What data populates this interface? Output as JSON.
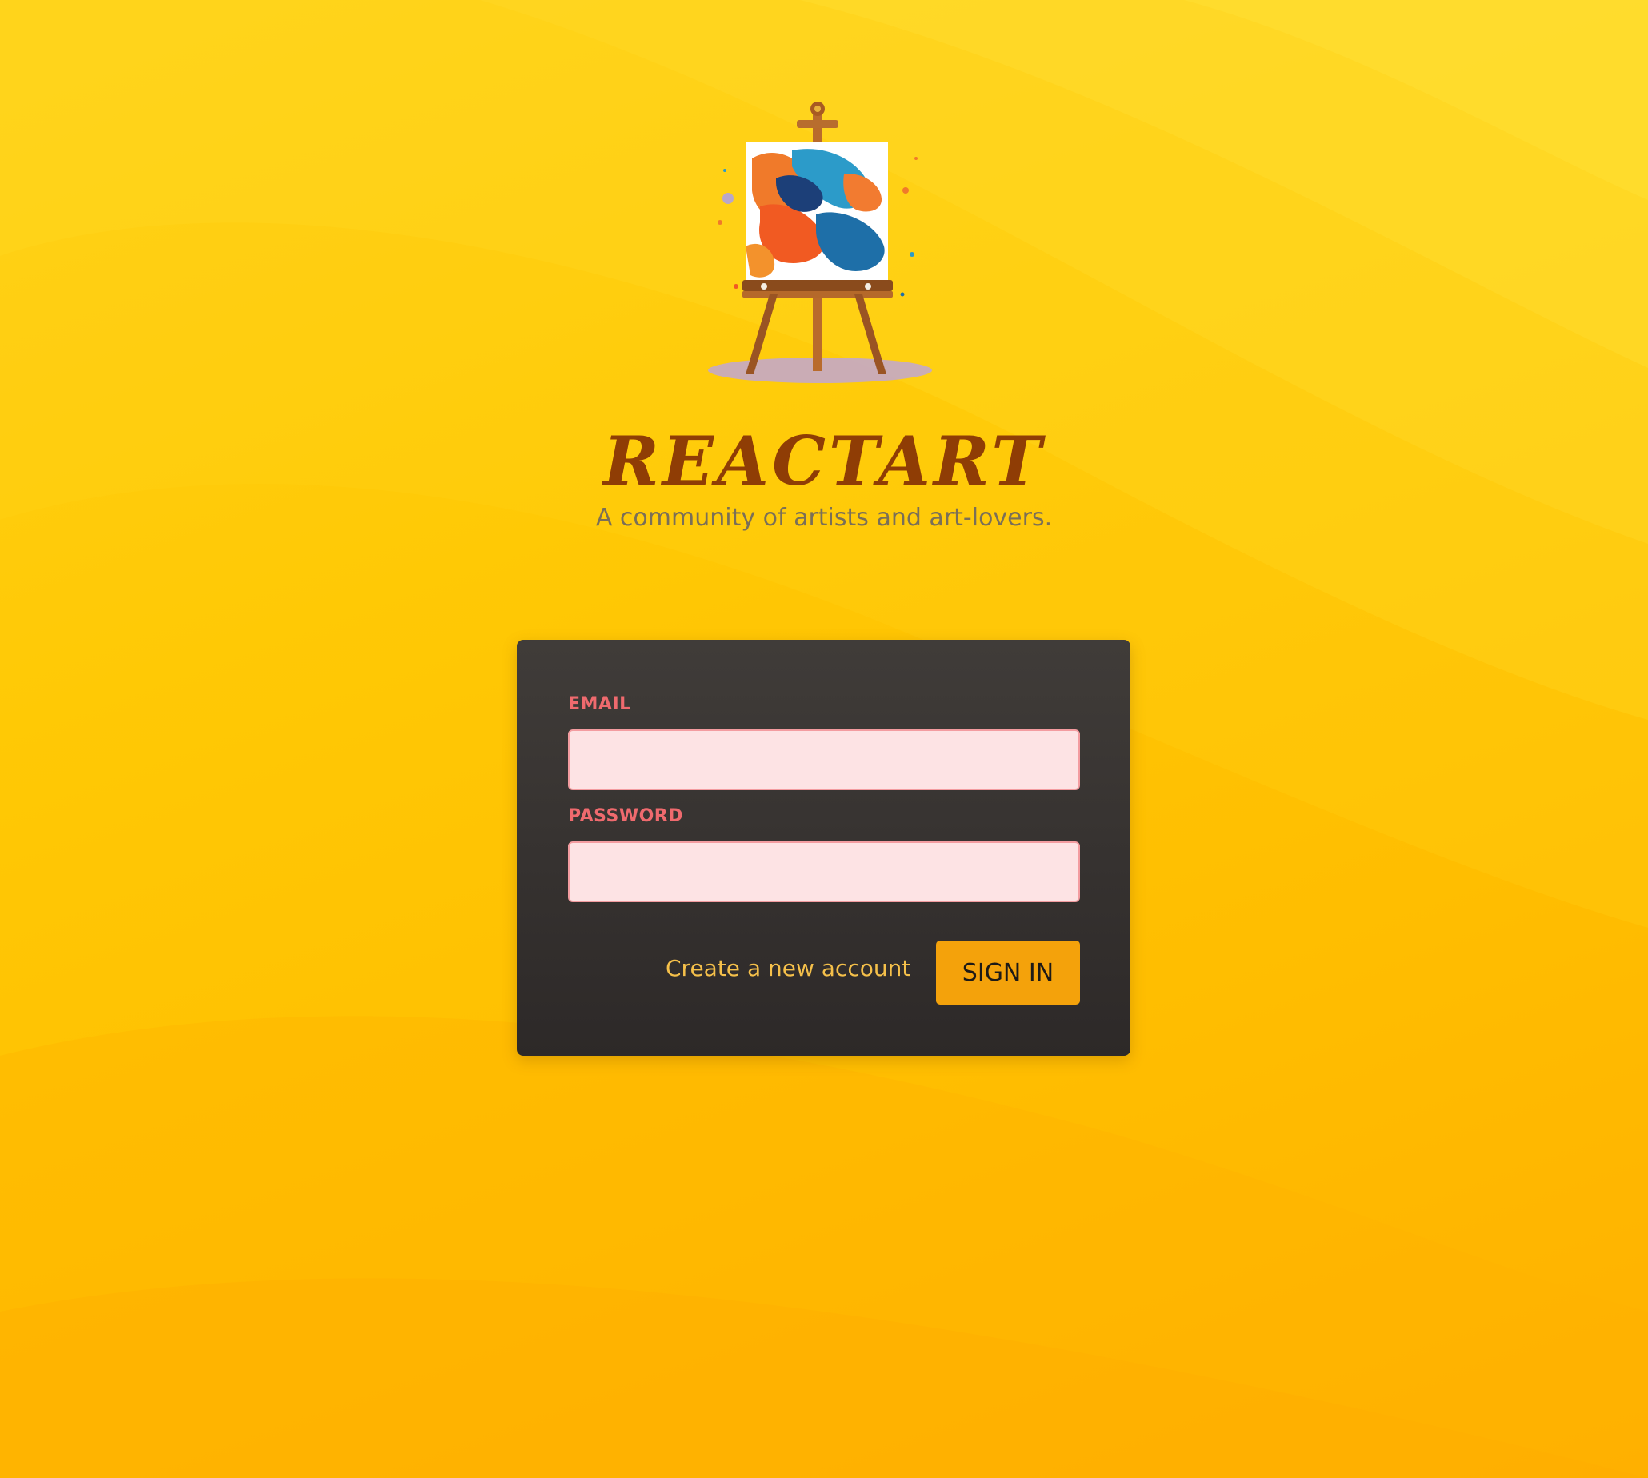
{
  "brand": {
    "title": "REACTART",
    "subtitle": "A community of artists and art-lovers."
  },
  "login_form": {
    "email": {
      "label": "EMAIL",
      "value": "",
      "placeholder": ""
    },
    "password": {
      "label": "PASSWORD",
      "value": "",
      "placeholder": ""
    },
    "create_account_link": "Create a new account",
    "sign_in_button": "SIGN IN"
  },
  "colors": {
    "background_top": "#ffd21a",
    "background_bottom": "#ffb000",
    "title": "#8f3d05",
    "subtitle": "#7a6f58",
    "card": "#363230",
    "field_label": "#ef6a6e",
    "input_fill": "#fde3e4",
    "input_border": "#f39ca0",
    "link": "#f5c04a",
    "button": "#f4a20b"
  },
  "icons": {
    "logo": "easel-painting-icon"
  }
}
